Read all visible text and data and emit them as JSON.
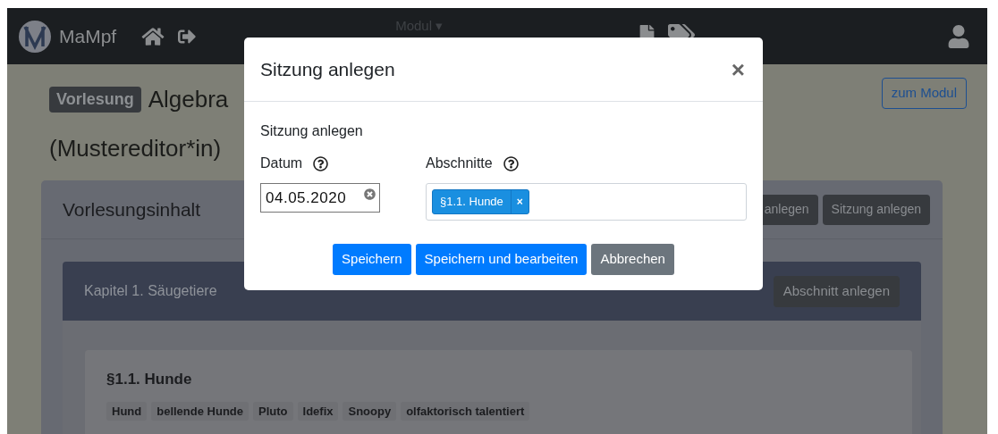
{
  "navbar": {
    "brand": "MaMpf",
    "menu": {
      "label": "Modul",
      "caret": "▾"
    }
  },
  "header": {
    "badge": "Vorlesung",
    "title": "Algebra",
    "subtitle": "(Mustereditor*in)",
    "module_button": "zum Modul"
  },
  "content_card": {
    "title": "Vorlesungsinhalt",
    "buttons": [
      "anlegen",
      "Sitzung anlegen"
    ],
    "chapter": {
      "title": "Kapitel 1. Säugetiere",
      "button": "Abschnitt anlegen",
      "section": {
        "title": "§1.1. Hunde",
        "tags": [
          "Hund",
          "bellende Hunde",
          "Pluto",
          "Idefix",
          "Snoopy",
          "olfaktorisch talentiert"
        ]
      }
    }
  },
  "modal": {
    "title": "Sitzung anlegen",
    "close": "×",
    "subtitle": "Sitzung anlegen",
    "date": {
      "label": "Datum",
      "value": "04.05.2020"
    },
    "sections": {
      "label": "Abschnitte",
      "chips": [
        {
          "label": "§1.1. Hunde",
          "remove": "×"
        }
      ]
    },
    "buttons": [
      {
        "label": "Speichern",
        "kind": "primary"
      },
      {
        "label": "Speichern und bearbeiten",
        "kind": "primary"
      },
      {
        "label": "Abbrechen",
        "kind": "secondary"
      }
    ]
  }
}
